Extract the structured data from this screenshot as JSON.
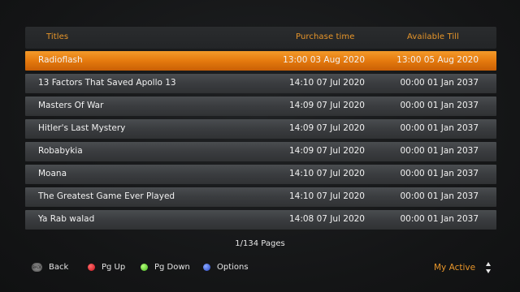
{
  "header": {
    "titles": "Titles",
    "purchase_time": "Purchase time",
    "available_till": "Available Till"
  },
  "rows": [
    {
      "title": "Radioflash",
      "purchase": "13:00 03 Aug 2020",
      "available": "13:00 05 Aug 2020",
      "selected": true
    },
    {
      "title": "13 Factors That Saved Apollo 13",
      "purchase": "14:10 07 Jul 2020",
      "available": "00:00 01 Jan 2037"
    },
    {
      "title": "Masters Of War",
      "purchase": "14:09 07 Jul 2020",
      "available": "00:00 01 Jan 2037"
    },
    {
      "title": "Hitler's Last Mystery",
      "purchase": "14:09 07 Jul 2020",
      "available": "00:00 01 Jan 2037"
    },
    {
      "title": "Robabykia",
      "purchase": "14:09 07 Jul 2020",
      "available": "00:00 01 Jan 2037"
    },
    {
      "title": "Moana",
      "purchase": "14:10 07 Jul 2020",
      "available": "00:00 01 Jan 2037"
    },
    {
      "title": "The Greatest Game Ever Played",
      "purchase": "14:10 07 Jul 2020",
      "available": "00:00 01 Jan 2037"
    },
    {
      "title": "Ya Rab walad",
      "purchase": "14:08 07 Jul 2020",
      "available": "00:00 01 Jan 2037"
    }
  ],
  "pagination": "1/134 Pages",
  "footer": {
    "back_label": "Back",
    "back_icon_text": "BACK",
    "pgup_label": "Pg Up",
    "pgdown_label": "Pg Down",
    "options_label": "Options",
    "filter_label": "My Active"
  },
  "colors": {
    "accent": "#e8962a",
    "selected_row": "#e57a0e",
    "row": "#3a3c3f",
    "red": "#c8141e",
    "green": "#43b41d",
    "blue": "#2747c8"
  }
}
